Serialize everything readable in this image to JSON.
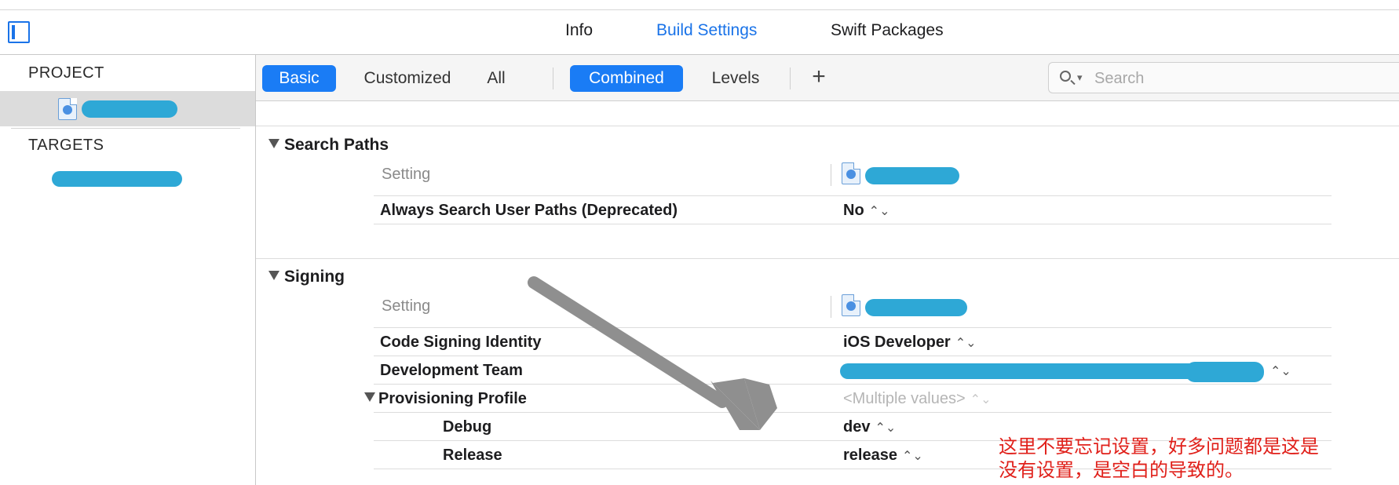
{
  "header": {
    "tabs": [
      {
        "label": "Info",
        "active": false
      },
      {
        "label": "Build Settings",
        "active": true
      },
      {
        "label": "Swift Packages",
        "active": false
      }
    ]
  },
  "sidebar": {
    "project_label": "PROJECT",
    "targets_label": "TARGETS"
  },
  "toolbar": {
    "filter_tabs": [
      {
        "label": "Basic",
        "active": true
      },
      {
        "label": "Customized",
        "active": false
      },
      {
        "label": "All",
        "active": false
      }
    ],
    "view_tabs": [
      {
        "label": "Combined",
        "active": true
      },
      {
        "label": "Levels",
        "active": false
      }
    ],
    "add_label": "+",
    "search_placeholder": "Search"
  },
  "sections": {
    "search_paths": {
      "title": "Search Paths",
      "setting_header": "Setting",
      "rows": [
        {
          "label": "Always Search User Paths (Deprecated)",
          "value": "No"
        }
      ]
    },
    "signing": {
      "title": "Signing",
      "setting_header": "Setting",
      "code_signing_identity": {
        "label": "Code Signing Identity",
        "value": "iOS Developer"
      },
      "development_team": {
        "label": "Development Team"
      },
      "provisioning_profile": {
        "label": "Provisioning Profile",
        "value": "<Multiple values>"
      },
      "debug": {
        "label": "Debug",
        "value": "dev"
      },
      "release": {
        "label": "Release",
        "value": "release"
      }
    }
  },
  "annotation": {
    "line1": "这里不要忘记设置，好多问题都是这是",
    "line2": "没有设置，是空白的导致的。"
  },
  "colors": {
    "accent": "#1a7cf5",
    "annotation": "#e0201a",
    "redaction": "#2ea8d6"
  }
}
